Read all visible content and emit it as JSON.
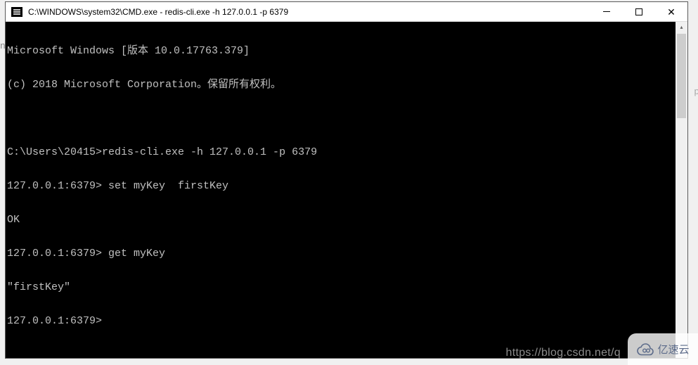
{
  "window": {
    "title": "C:\\WINDOWS\\system32\\CMD.exe - redis-cli.exe  -h 127.0.0.1 -p 6379"
  },
  "terminal": {
    "lines": [
      "Microsoft Windows [版本 10.0.17763.379]",
      "(c) 2018 Microsoft Corporation。保留所有权利。",
      "",
      "C:\\Users\\20415>redis-cli.exe -h 127.0.0.1 -p 6379",
      "127.0.0.1:6379> set myKey  firstKey",
      "OK",
      "127.0.0.1:6379> get myKey",
      "\"firstKey\"",
      "127.0.0.1:6379>"
    ]
  },
  "watermark": {
    "url": "https://blog.csdn.net/q",
    "brand": "亿速云"
  },
  "background_fragments": {
    "left": "n",
    "right": "p"
  }
}
